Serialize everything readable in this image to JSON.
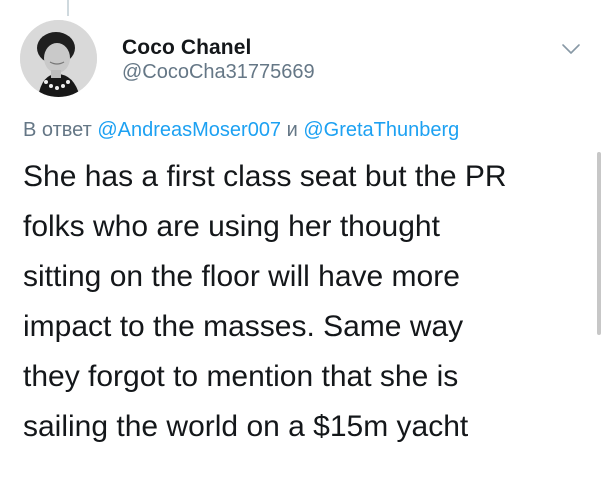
{
  "tweet": {
    "display_name": "Coco Chanel",
    "handle": "@CocoCha31775669",
    "reply": {
      "prefix": "В ответ",
      "mention_1": "@AndreasMoser007",
      "conjunction": "и",
      "mention_2": "@GretaThunberg"
    },
    "text": "She has a first class seat but the PR\nfolks who are using her thought\nsitting on the floor will have more\nimpact to the masses.  Same way\nthey forgot to mention that she is\nsailing the world on a $15m yacht"
  },
  "icons": {
    "avatar": "user-avatar-photo",
    "menu": "chevron-down-icon"
  },
  "colors": {
    "text_primary": "#14171a",
    "text_secondary": "#657786",
    "link": "#1da1f2",
    "divider": "#cfd9de"
  }
}
